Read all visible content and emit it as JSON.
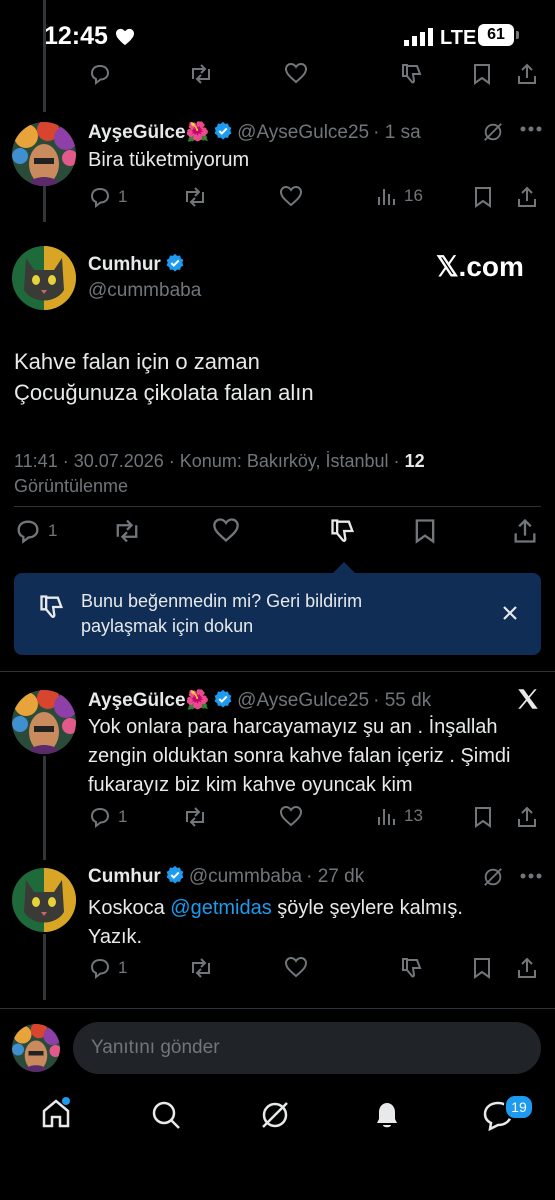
{
  "status_bar": {
    "time": "12:45",
    "network": "LTE",
    "battery": "61"
  },
  "colors": {
    "accent": "#1d9bf0",
    "muted": "#71767b",
    "banner": "#0f2d55"
  },
  "tweets": [
    {
      "name": "AyşeGülce🌺",
      "handle": "@AyseGulce25",
      "time": "· 1 sa",
      "text": "Bira tüketmiyorum",
      "replies": "1",
      "views": "16"
    }
  ],
  "main_tweet": {
    "name": "Cumhur",
    "handle": "@cummbaba",
    "badge": "𝕏.com",
    "text_line1": "Kahve falan için o zaman",
    "text_line2": "Çocuğunuza çikolata falan alın",
    "meta": "11:41 · 30.07.2026 · Konum: Bakırköy, İstanbul ·",
    "views_count": "12",
    "views_label": "Görüntülenme",
    "replies": "1"
  },
  "feedback_banner": {
    "line1": "Bunu beğenmedin mi? Geri bildirim",
    "line2": "paylaşmak için dokun"
  },
  "replies": [
    {
      "name": "AyşeGülce🌺",
      "handle": "@AyseGulce25",
      "time": "· 55 dk",
      "line1": "Yok onlara para harcayamayız şu an . İnşallah",
      "line2": "zengin olduktan sonra kahve falan içeriz . Şimdi",
      "line3": "fukarayız biz kim kahve oyuncak kim",
      "replies": "1",
      "views": "13"
    },
    {
      "name": "Cumhur",
      "handle": "@cummbaba",
      "time": "· 27 dk",
      "line1_prefix": "Koskoca ",
      "mention": "@getmidas",
      "line1_suffix": " şöyle şeylere kalmış.",
      "line2": "Yazık.",
      "replies": "1"
    }
  ],
  "composer": {
    "placeholder": "Yanıtını gönder"
  },
  "bottom_nav": {
    "messages_badge": "19"
  }
}
